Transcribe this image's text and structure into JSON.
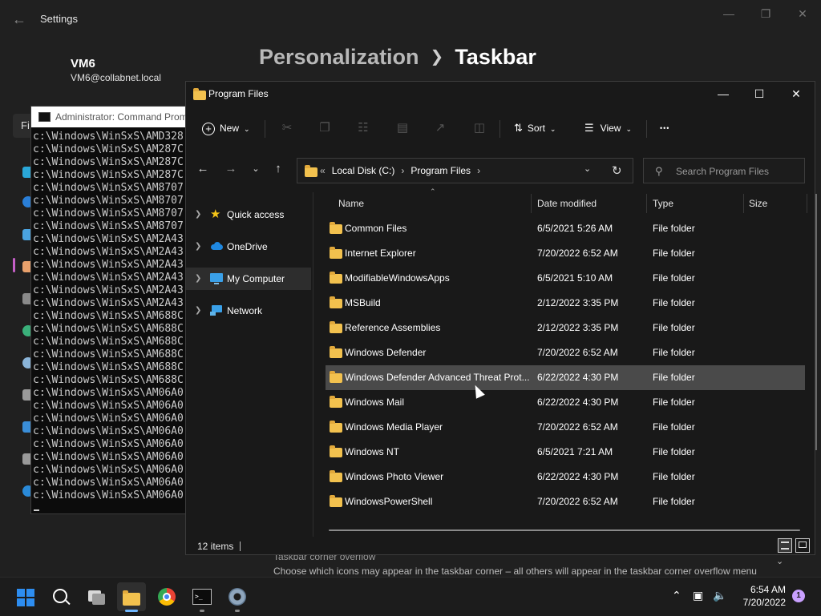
{
  "settings": {
    "app_title": "Settings",
    "user_name": "VM6",
    "user_email": "VM6@collabnet.local",
    "breadcrumb_parent": "Personalization",
    "breadcrumb_current": "Taskbar",
    "find_label": "Fi",
    "overflow_title": "Taskbar corner overflow",
    "overflow_desc": "Choose which icons may appear in the taskbar corner – all others will appear in the taskbar corner overflow menu"
  },
  "cmd": {
    "title": "Administrator: Command Prompt",
    "lines": [
      "c:\\Windows\\WinSxS\\AMD328",
      "c:\\Windows\\WinSxS\\AM287C",
      "c:\\Windows\\WinSxS\\AM287C",
      "c:\\Windows\\WinSxS\\AM287C",
      "c:\\Windows\\WinSxS\\AM8707",
      "c:\\Windows\\WinSxS\\AM8707",
      "c:\\Windows\\WinSxS\\AM8707",
      "c:\\Windows\\WinSxS\\AM8707",
      "c:\\Windows\\WinSxS\\AM2A43",
      "c:\\Windows\\WinSxS\\AM2A43",
      "c:\\Windows\\WinSxS\\AM2A43",
      "c:\\Windows\\WinSxS\\AM2A43",
      "c:\\Windows\\WinSxS\\AM2A43",
      "c:\\Windows\\WinSxS\\AM2A43",
      "c:\\Windows\\WinSxS\\AM688C",
      "c:\\Windows\\WinSxS\\AM688C",
      "c:\\Windows\\WinSxS\\AM688C",
      "c:\\Windows\\WinSxS\\AM688C",
      "c:\\Windows\\WinSxS\\AM688C",
      "c:\\Windows\\WinSxS\\AM688C",
      "c:\\Windows\\WinSxS\\AM06A0",
      "c:\\Windows\\WinSxS\\AM06A0",
      "c:\\Windows\\WinSxS\\AM06A0",
      "c:\\Windows\\WinSxS\\AM06A0",
      "c:\\Windows\\WinSxS\\AM06A0",
      "c:\\Windows\\WinSxS\\AM06A0",
      "c:\\Windows\\WinSxS\\AM06A0",
      "c:\\Windows\\WinSxS\\AM06A0",
      "c:\\Windows\\WinSxS\\AM06A0"
    ]
  },
  "explorer": {
    "title": "Program Files",
    "toolbar": {
      "new_label": "New",
      "sort_label": "Sort",
      "view_label": "View",
      "more_label": "•••"
    },
    "address": {
      "prefix": "«",
      "segments": [
        "Local Disk (C:)",
        "Program Files"
      ]
    },
    "search_placeholder": "Search Program Files",
    "nav": [
      {
        "label": "Quick access",
        "icon": "star-icon"
      },
      {
        "label": "OneDrive",
        "icon": "cloud-icon"
      },
      {
        "label": "My Computer",
        "icon": "computer-icon",
        "selected": true
      },
      {
        "label": "Network",
        "icon": "network-icon"
      }
    ],
    "columns": {
      "name": "Name",
      "date": "Date modified",
      "type": "Type",
      "size": "Size"
    },
    "rows": [
      {
        "name": "Common Files",
        "date": "6/5/2021 5:26 AM",
        "type": "File folder"
      },
      {
        "name": "Internet Explorer",
        "date": "7/20/2022 6:52 AM",
        "type": "File folder"
      },
      {
        "name": "ModifiableWindowsApps",
        "date": "6/5/2021 5:10 AM",
        "type": "File folder"
      },
      {
        "name": "MSBuild",
        "date": "2/12/2022 3:35 PM",
        "type": "File folder"
      },
      {
        "name": "Reference Assemblies",
        "date": "2/12/2022 3:35 PM",
        "type": "File folder"
      },
      {
        "name": "Windows Defender",
        "date": "7/20/2022 6:52 AM",
        "type": "File folder"
      },
      {
        "name": "Windows Defender Advanced Threat Prot...",
        "date": "6/22/2022 4:30 PM",
        "type": "File folder",
        "selected": true
      },
      {
        "name": "Windows Mail",
        "date": "6/22/2022 4:30 PM",
        "type": "File folder"
      },
      {
        "name": "Windows Media Player",
        "date": "7/20/2022 6:52 AM",
        "type": "File folder"
      },
      {
        "name": "Windows NT",
        "date": "6/5/2021 7:21 AM",
        "type": "File folder"
      },
      {
        "name": "Windows Photo Viewer",
        "date": "6/22/2022 4:30 PM",
        "type": "File folder"
      },
      {
        "name": "WindowsPowerShell",
        "date": "7/20/2022 6:52 AM",
        "type": "File folder"
      }
    ],
    "status": "12 items"
  },
  "taskbar": {
    "apps": [
      "start-icon",
      "search-icon",
      "task-view-icon",
      "file-explorer-icon",
      "chrome-icon",
      "terminal-icon",
      "settings-icon"
    ],
    "time": "6:54 AM",
    "date": "7/20/2022",
    "notifications": "1"
  },
  "colors": {
    "accent": "#6fb7ff",
    "folder": "#f2c14e",
    "selection": "#4a4a4a"
  }
}
